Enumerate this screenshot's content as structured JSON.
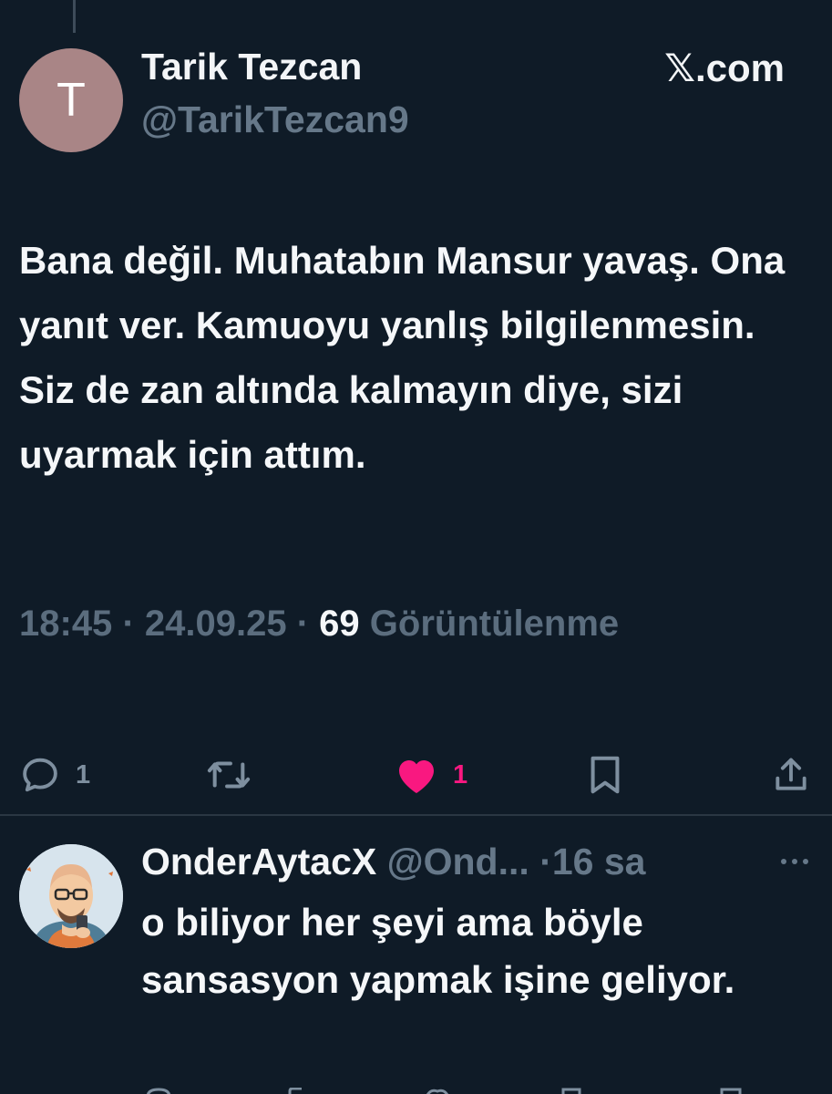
{
  "tweet": {
    "avatar_letter": "T",
    "author_name": "Tarik Tezcan",
    "handle": "@TarikTezcan9",
    "source": "𝕏.com",
    "text": "Bana değil. Muhatabın Mansur yavaş. Ona yanıt ver. Kamuoyu yanlış bilgilenmesin. Siz de zan altında kalmayın diye, sizi uyarmak için attım.",
    "time": "18:45",
    "separator": "·",
    "date": "24.09.25",
    "views_count": "69",
    "views_label": "Görüntülenme"
  },
  "actions": {
    "reply_count": "1",
    "like_count": "1",
    "like_color": "#f91880",
    "icon_names": [
      "reply-icon",
      "retweet-icon",
      "like-icon",
      "bookmark-icon",
      "share-icon"
    ]
  },
  "reply": {
    "author_name": "OnderAytacX",
    "handle": "@Ond...",
    "separator": "·",
    "time": "16 sa",
    "text": "o biliyor her şeyi ama böyle sansasyon yapmak işine geliyor."
  },
  "colors": {
    "background": "#0f1b27",
    "primary_text": "#f5f7f9",
    "secondary_text": "#667889",
    "avatar_bg": "#a98586"
  }
}
